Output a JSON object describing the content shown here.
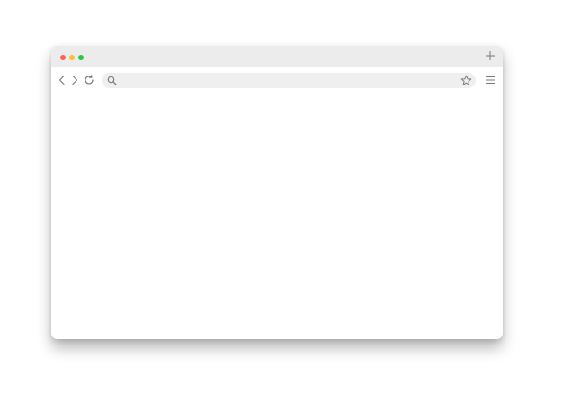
{
  "window": {
    "controls": [
      {
        "name": "close",
        "color": "#ff5f57"
      },
      {
        "name": "minimize",
        "color": "#febc2e"
      },
      {
        "name": "maximize",
        "color": "#28c840"
      }
    ],
    "new_tab_icon": "plus-icon"
  },
  "toolbar": {
    "back_icon": "chevron-left-icon",
    "forward_icon": "chevron-right-icon",
    "reload_icon": "reload-icon",
    "menu_icon": "hamburger-menu-icon"
  },
  "address_bar": {
    "value": "",
    "placeholder": "",
    "search_icon": "search-icon",
    "bookmark_icon": "star-icon"
  },
  "colors": {
    "titlebar_bg": "#ececec",
    "address_bg": "#efefef",
    "icon_color": "#7a7a7a"
  }
}
